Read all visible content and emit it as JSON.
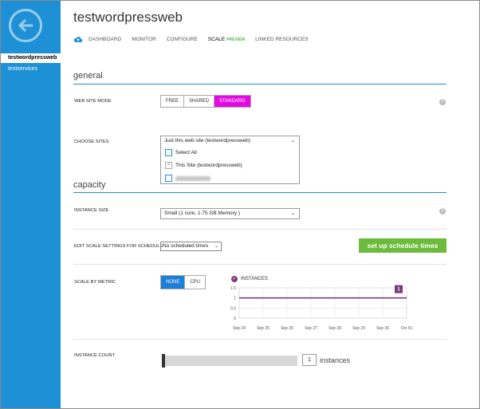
{
  "sidebar": {
    "items": [
      {
        "label": "testwordpressweb"
      },
      {
        "label": "testservices"
      }
    ]
  },
  "header": {
    "title": "testwordpressweb",
    "tabs": [
      {
        "label": "DASHBOARD"
      },
      {
        "label": "MONITOR"
      },
      {
        "label": "CONFIGURE"
      },
      {
        "label": "SCALE",
        "badge": "PREVIEW"
      },
      {
        "label": "LINKED RESOURCES"
      }
    ]
  },
  "general": {
    "heading": "general",
    "mode_label": "WEB SITE MODE",
    "modes": [
      "FREE",
      "SHARED",
      "STANDARD"
    ],
    "selected_mode": "STANDARD",
    "sites_label": "CHOOSE SITES",
    "sites_value": "Just this web site (testwordpressweb)",
    "dropdown": {
      "select_all": "Select All",
      "this_site": "This Site (testwordpressweb)"
    }
  },
  "capacity": {
    "heading": "capacity",
    "instance_size_label": "INSTANCE SIZE",
    "instance_size_value": "Small (1 core, 1.75 GB Memory )",
    "schedule_label": "EDIT SCALE SETTINGS FOR SCHEDULE",
    "schedule_value": "No scheduled times",
    "schedule_button": "set up schedule times",
    "metric_label": "SCALE BY METRIC",
    "metric_options": [
      "NONE",
      "CPU"
    ],
    "selected_metric": "NONE",
    "instance_count_label": "INSTANCE COUNT",
    "instance_count": "1",
    "instances_unit": "instances"
  },
  "chart_data": {
    "type": "line",
    "legend": "INSTANCES",
    "legend_badge": "1",
    "x": [
      "Sep 24",
      "Sep 25",
      "Sep 26",
      "Sep 27",
      "Sep 28",
      "Sep 29",
      "Sep 30",
      "Oct 01"
    ],
    "series": [
      {
        "name": "INSTANCES",
        "values": [
          1,
          1,
          1,
          1,
          1,
          1,
          1,
          1
        ]
      }
    ],
    "y_ticks": [
      "1.5",
      "1",
      "0.5",
      "0"
    ],
    "ylim": [
      0,
      1.5
    ],
    "end_marker": "1",
    "color": "#7b3a7b"
  },
  "colors": {
    "sidebar": "#1e91d6",
    "standard_selected": "#e20ae2",
    "metric_selected": "#1e7fd8",
    "schedule_button": "#6cbb3c",
    "series": "#7b3a7b"
  },
  "icons": {
    "back": "back-arrow-icon",
    "cloud": "cloud-icon",
    "help": "help-icon"
  }
}
